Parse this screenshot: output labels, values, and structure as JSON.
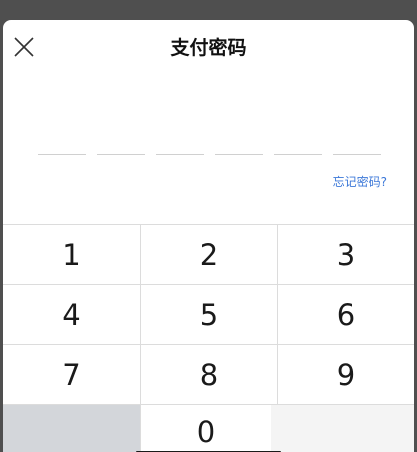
{
  "dialog": {
    "title": "支付密码",
    "close_icon": "close-icon",
    "pin_length": 6,
    "forgot_label": "忘记密码?"
  },
  "keypad": {
    "keys": [
      "1",
      "2",
      "3",
      "4",
      "5",
      "6",
      "7",
      "8",
      "9",
      "",
      "0",
      ""
    ]
  },
  "colors": {
    "link": "#3c78d8",
    "overlay": "#4f4f4f",
    "blank_key": "#d3d6da"
  }
}
